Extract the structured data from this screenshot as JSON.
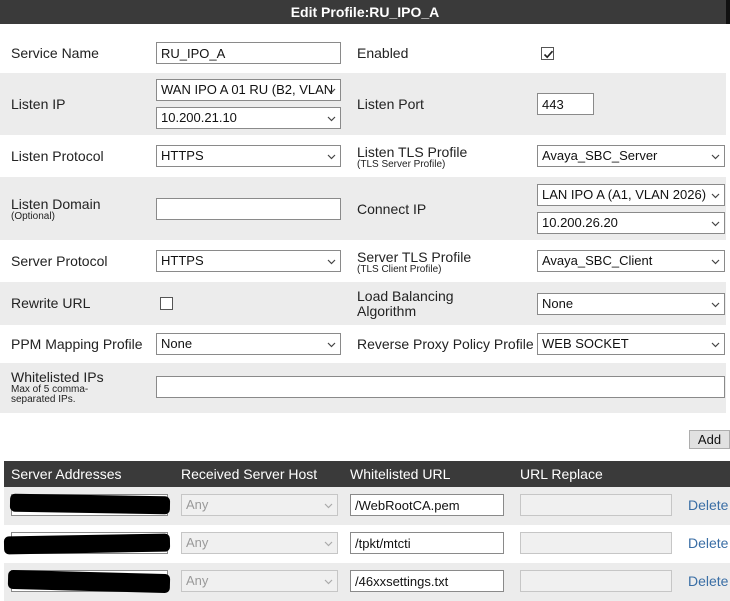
{
  "title": "Edit Profile:RU_IPO_A",
  "fields": {
    "service_name": {
      "label": "Service Name",
      "value": "RU_IPO_A"
    },
    "enabled": {
      "label": "Enabled",
      "checked": true
    },
    "listen_ip": {
      "label": "Listen IP",
      "interface": "WAN IPO A 01 RU (B2, VLAN",
      "address": "10.200.21.10"
    },
    "listen_port": {
      "label": "Listen Port",
      "value": "443"
    },
    "listen_protocol": {
      "label": "Listen Protocol",
      "value": "HTTPS"
    },
    "listen_tls_profile": {
      "label": "Listen TLS Profile",
      "sublabel": "(TLS Server Profile)",
      "value": "Avaya_SBC_Server"
    },
    "listen_domain": {
      "label": "Listen Domain",
      "sublabel": "(Optional)",
      "value": ""
    },
    "connect_ip": {
      "label": "Connect IP",
      "interface": "LAN IPO A (A1, VLAN 2026)",
      "address": "10.200.26.20"
    },
    "server_protocol": {
      "label": "Server Protocol",
      "value": "HTTPS"
    },
    "server_tls_profile": {
      "label": "Server TLS Profile",
      "sublabel": "(TLS Client Profile)",
      "value": "Avaya_SBC_Client"
    },
    "rewrite_url": {
      "label": "Rewrite URL",
      "checked": false
    },
    "load_balancing": {
      "label_line1": "Load Balancing",
      "label_line2": "Algorithm",
      "value": "None"
    },
    "ppm_mapping": {
      "label": "PPM Mapping Profile",
      "value": "None"
    },
    "reverse_proxy_policy": {
      "label": "Reverse Proxy Policy Profile",
      "value": "WEB SOCKET"
    },
    "whitelisted_ips": {
      "label": "Whitelisted IPs",
      "sublabel_line1": "Max of 5 comma-",
      "sublabel_line2": "separated IPs.",
      "value": ""
    }
  },
  "add_button": "Add",
  "table": {
    "columns": [
      "Server Addresses",
      "Received Server Host",
      "Whitelisted URL",
      "URL Replace"
    ],
    "rows": [
      {
        "server_host": "Any",
        "whitelisted_url": "/WebRootCA.pem",
        "url_replace": "",
        "action": "Delete"
      },
      {
        "server_host": "Any",
        "whitelisted_url": "/tpkt/mtcti",
        "url_replace": "",
        "action": "Delete"
      },
      {
        "server_host": "Any",
        "whitelisted_url": "/46xxsettings.txt",
        "url_replace": "",
        "action": "Delete"
      }
    ]
  }
}
